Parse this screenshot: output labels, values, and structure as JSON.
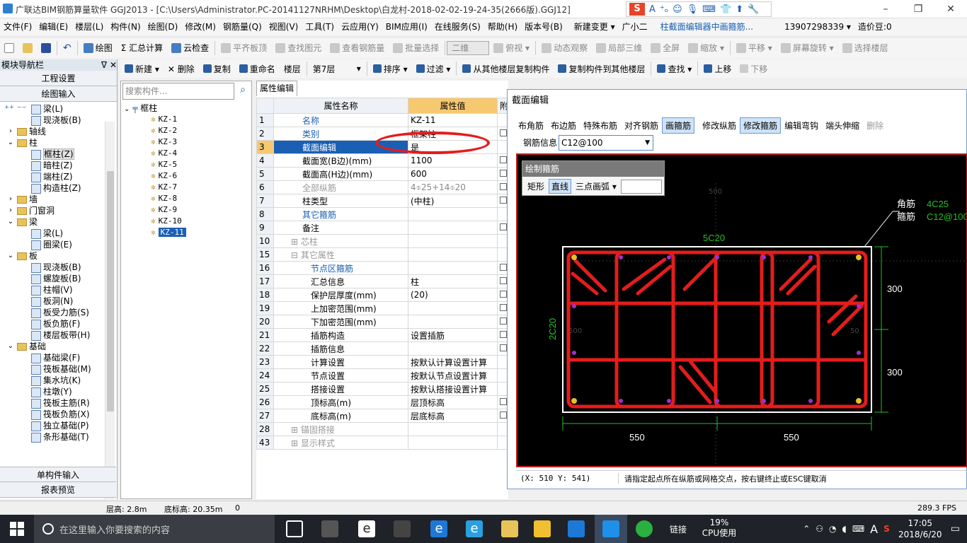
{
  "title": "广联达BIM钢筋算量软件 GGJ2013 - [C:\\Users\\Administrator.PC-20141127NRHM\\Desktop\\白龙村-2018-02-02-19-24-35(2666版).GGJ12]",
  "window_buttons": [
    "–",
    "❐",
    "✕"
  ],
  "ime": {
    "logo": "S",
    "items": [
      "A",
      "⁺ₒ",
      "☺",
      "🎙",
      "⌨",
      "👕",
      "⬆",
      "🔧"
    ]
  },
  "menu": [
    "文件(F)",
    "编辑(E)",
    "楼层(L)",
    "构件(N)",
    "绘图(D)",
    "修改(M)",
    "钢筋量(Q)",
    "视图(V)",
    "工具(T)",
    "云应用(Y)",
    "BIM应用(I)",
    "在线服务(S)",
    "帮助(H)",
    "版本号(B)",
    "新建变更 ▾",
    "广小二",
    "柱截面编辑器中画箍筋...",
    "13907298339 ▾",
    "造价豆:0"
  ],
  "toolbar1": [
    "绘图",
    "Σ 汇总计算",
    "云检查",
    "平齐板顶",
    "查找图元",
    "查看钢筋量",
    "批量选择",
    "二维",
    "俯视 ▾",
    "动态观察",
    "局部三维",
    "全屏",
    "缩放 ▾",
    "平移 ▾",
    "屏幕旋转 ▾",
    "选择楼层"
  ],
  "toolbar2": [
    "新建 ▾",
    "✕ 删除",
    "复制",
    "重命名",
    "楼层",
    "第7层",
    "排序 ▾",
    "过滤 ▾",
    "从其他楼层复制构件",
    "复制构件到其他楼层",
    "查找 ▾",
    "上移",
    "下移"
  ],
  "nav": {
    "header": "模块导航栏",
    "pin": "ᐁ ✕",
    "top_buttons": [
      "工程设置",
      "绘图输入"
    ],
    "bottom_buttons": [
      "单构件输入",
      "报表预览"
    ],
    "tree": [
      {
        "label": "梁(L)",
        "lvl": 2
      },
      {
        "label": "现浇板(B)",
        "lvl": 2
      },
      {
        "label": "轴线",
        "lvl": 0,
        "folder": true,
        "exp": "›"
      },
      {
        "label": "柱",
        "lvl": 0,
        "folder": true,
        "exp": "⌄"
      },
      {
        "label": "框柱(Z)",
        "lvl": 2,
        "sel": true
      },
      {
        "label": "暗柱(Z)",
        "lvl": 2
      },
      {
        "label": "端柱(Z)",
        "lvl": 2
      },
      {
        "label": "构造柱(Z)",
        "lvl": 2
      },
      {
        "label": "墙",
        "lvl": 0,
        "folder": true,
        "exp": "›"
      },
      {
        "label": "门窗洞",
        "lvl": 0,
        "folder": true,
        "exp": "›"
      },
      {
        "label": "梁",
        "lvl": 0,
        "folder": true,
        "exp": "⌄"
      },
      {
        "label": "梁(L)",
        "lvl": 2
      },
      {
        "label": "圈梁(E)",
        "lvl": 2
      },
      {
        "label": "板",
        "lvl": 0,
        "folder": true,
        "exp": "⌄"
      },
      {
        "label": "现浇板(B)",
        "lvl": 2
      },
      {
        "label": "螺旋板(B)",
        "lvl": 2
      },
      {
        "label": "柱帽(V)",
        "lvl": 2
      },
      {
        "label": "板洞(N)",
        "lvl": 2
      },
      {
        "label": "板受力筋(S)",
        "lvl": 2
      },
      {
        "label": "板负筋(F)",
        "lvl": 2
      },
      {
        "label": "楼层板带(H)",
        "lvl": 2
      },
      {
        "label": "基础",
        "lvl": 0,
        "folder": true,
        "exp": "⌄"
      },
      {
        "label": "基础梁(F)",
        "lvl": 2
      },
      {
        "label": "筏板基础(M)",
        "lvl": 2
      },
      {
        "label": "集水坑(K)",
        "lvl": 2
      },
      {
        "label": "柱墩(Y)",
        "lvl": 2
      },
      {
        "label": "筏板主筋(R)",
        "lvl": 2
      },
      {
        "label": "筏板负筋(X)",
        "lvl": 2
      },
      {
        "label": "独立基础(P)",
        "lvl": 2
      },
      {
        "label": "条形基础(T)",
        "lvl": 2
      }
    ]
  },
  "components": {
    "search_placeholder": "搜索构件...",
    "root": "框柱",
    "items": [
      "KZ-1",
      "KZ-2",
      "KZ-3",
      "KZ-4",
      "KZ-5",
      "KZ-6",
      "KZ-7",
      "KZ-8",
      "KZ-9",
      "KZ-10",
      "KZ-11"
    ],
    "selected": "KZ-11"
  },
  "props": {
    "tab": "属性编辑",
    "headers": [
      "属性名称",
      "属性值",
      "附"
    ],
    "rows": [
      {
        "n": "1",
        "name": "名称",
        "val": "KZ-11",
        "style": "blue",
        "cb": false
      },
      {
        "n": "2",
        "name": "类别",
        "val": "框架柱",
        "style": "blue",
        "cb": true
      },
      {
        "n": "3",
        "name": "截面编辑",
        "val": "是",
        "style": "sel",
        "cb": false
      },
      {
        "n": "4",
        "name": "截面宽(B边)(mm)",
        "val": "1100",
        "style": "",
        "cb": true
      },
      {
        "n": "5",
        "name": "截面高(H边)(mm)",
        "val": "600",
        "style": "",
        "cb": true
      },
      {
        "n": "6",
        "name": "全部纵筋",
        "val": "4⌽25+14⌽20",
        "style": "gray",
        "cb": true
      },
      {
        "n": "7",
        "name": "柱类型",
        "val": "(中柱)",
        "style": "",
        "cb": true
      },
      {
        "n": "8",
        "name": "其它箍筋",
        "val": "",
        "style": "blue",
        "cb": false
      },
      {
        "n": "9",
        "name": "备注",
        "val": "",
        "style": "",
        "cb": true
      },
      {
        "n": "10",
        "name": "⊞ 芯柱",
        "val": "",
        "style": "gray",
        "cb": false
      },
      {
        "n": "15",
        "name": "⊟ 其它属性",
        "val": "",
        "style": "gray",
        "cb": false
      },
      {
        "n": "16",
        "name": "　节点区箍筋",
        "val": "",
        "style": "blue",
        "cb": true
      },
      {
        "n": "17",
        "name": "　汇总信息",
        "val": "柱",
        "style": "",
        "cb": true
      },
      {
        "n": "18",
        "name": "　保护层厚度(mm)",
        "val": "(20)",
        "style": "",
        "cb": true
      },
      {
        "n": "19",
        "name": "　上加密范围(mm)",
        "val": "",
        "style": "",
        "cb": true
      },
      {
        "n": "20",
        "name": "　下加密范围(mm)",
        "val": "",
        "style": "",
        "cb": true
      },
      {
        "n": "21",
        "name": "　插筋构造",
        "val": "设置插筋",
        "style": "",
        "cb": true
      },
      {
        "n": "22",
        "name": "　插筋信息",
        "val": "",
        "style": "",
        "cb": true
      },
      {
        "n": "23",
        "name": "　计算设置",
        "val": "按默认计算设置计算",
        "style": "",
        "cb": false
      },
      {
        "n": "24",
        "name": "　节点设置",
        "val": "按默认节点设置计算",
        "style": "",
        "cb": false
      },
      {
        "n": "25",
        "name": "　搭接设置",
        "val": "按默认搭接设置计算",
        "style": "",
        "cb": false
      },
      {
        "n": "26",
        "name": "　顶标高(m)",
        "val": "层顶标高",
        "style": "",
        "cb": true
      },
      {
        "n": "27",
        "name": "　底标高(m)",
        "val": "层底标高",
        "style": "",
        "cb": true
      },
      {
        "n": "28",
        "name": "⊞ 锚固搭接",
        "val": "",
        "style": "gray",
        "cb": false
      },
      {
        "n": "43",
        "name": "⊞ 显示样式",
        "val": "",
        "style": "gray",
        "cb": false
      }
    ]
  },
  "dialog": {
    "title": "截面编辑",
    "toolbar": [
      {
        "label": "布角筋",
        "state": ""
      },
      {
        "label": "布边筋",
        "state": ""
      },
      {
        "label": "特殊布筋",
        "state": ""
      },
      {
        "label": "对齐钢筋",
        "state": ""
      },
      {
        "label": "画箍筋",
        "state": "act"
      },
      {
        "label": "修改纵筋",
        "state": ""
      },
      {
        "label": "修改箍筋",
        "state": "act"
      },
      {
        "label": "编辑弯钩",
        "state": ""
      },
      {
        "label": "端头伸缩",
        "state": ""
      },
      {
        "label": "删除",
        "state": "dis"
      }
    ],
    "rebar_info_label": "钢筋信息",
    "rebar_info_value": "C12@100",
    "draw_panel": {
      "title": "绘制箍筋",
      "buttons": [
        "矩形",
        "直线",
        "三点画弧 ▾"
      ],
      "active": "直线"
    },
    "canvas": {
      "corner_label": "角筋",
      "corner_value": "4C25",
      "stirrup_label": "箍筋",
      "stirrup_value": "C12@100",
      "top_label": "5C20",
      "side_label": "2C20",
      "dim_right": [
        "300",
        "300"
      ],
      "dim_bottom": [
        "550",
        "550"
      ],
      "ghost_top": "500",
      "ghost_left": "500",
      "ghost_right": "50"
    },
    "status_coords": "(X: 510 Y: 541)",
    "status_hint": "请指定起点所在纵筋或网格交点，按右键终止或ESC键取消"
  },
  "statusbar": {
    "floor_height": "层高: 2.8m",
    "bottom_elev": "底标高: 20.35m",
    "zero": "0",
    "fps": "289.3 FPS"
  },
  "taskbar": {
    "search_placeholder": "在这里输入你要搜索的内容",
    "link": "链接",
    "cpu_pct": "19%",
    "cpu_label": "CPU使用",
    "ime": "A",
    "time": "17:05",
    "date": "2018/6/20"
  },
  "colors": {
    "rebar": "#e51c1c",
    "dim": "#22c022",
    "select": "#1a5fb4",
    "accent_header": "#f6c870"
  }
}
